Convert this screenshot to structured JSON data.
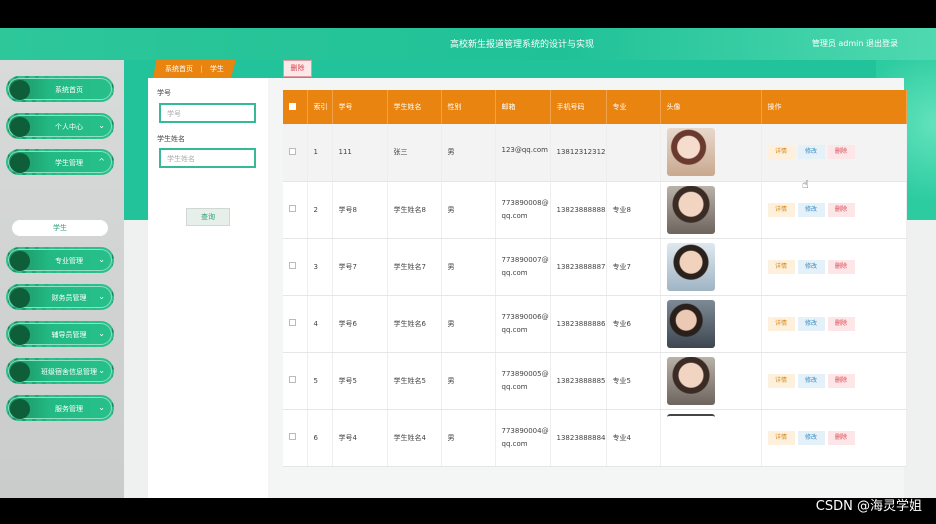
{
  "header": {
    "title": "高校新生报道管理系统的设计与实现",
    "admin": "管理员 admin 退出登录"
  },
  "sidebar": {
    "items": [
      {
        "label": "系统首页",
        "chevron": ""
      },
      {
        "label": "个人中心",
        "chevron": "⌄"
      },
      {
        "label": "学生管理",
        "chevron": "^"
      },
      {
        "label": "专业管理",
        "chevron": "⌄"
      },
      {
        "label": "财务员管理",
        "chevron": "⌄"
      },
      {
        "label": "辅导员管理",
        "chevron": "⌄"
      },
      {
        "label": "班级宿舍信息管理",
        "chevron": "⌄"
      },
      {
        "label": "服务管理",
        "chevron": "⌄"
      }
    ],
    "sub_item": "学生"
  },
  "breadcrumb": {
    "home": "系统首页",
    "sep": "|",
    "current": "学生"
  },
  "search": {
    "label_no": "学号",
    "placeholder_no": "学号",
    "label_name": "学生姓名",
    "placeholder_name": "学生姓名",
    "button": "查询"
  },
  "toolbar": {
    "delete": "删除"
  },
  "table": {
    "headers": [
      "",
      "索引",
      "学号",
      "学生姓名",
      "性别",
      "邮箱",
      "手机号码",
      "专业",
      "头像",
      "操作"
    ],
    "ops": {
      "detail": "详情",
      "edit": "修改",
      "delete": "删除"
    },
    "rows": [
      {
        "idx": "1",
        "no": "111",
        "name": "张三",
        "sex": "男",
        "email1": "123@qq.com",
        "email2": "",
        "phone": "13812312312",
        "major": ""
      },
      {
        "idx": "2",
        "no": "学号8",
        "name": "学生姓名8",
        "sex": "男",
        "email1": "773890008@",
        "email2": "qq.com",
        "phone": "13823888888",
        "major": "专业8"
      },
      {
        "idx": "3",
        "no": "学号7",
        "name": "学生姓名7",
        "sex": "男",
        "email1": "773890007@",
        "email2": "qq.com",
        "phone": "13823888887",
        "major": "专业7"
      },
      {
        "idx": "4",
        "no": "学号6",
        "name": "学生姓名6",
        "sex": "男",
        "email1": "773890006@",
        "email2": "qq.com",
        "phone": "13823888886",
        "major": "专业6"
      },
      {
        "idx": "5",
        "no": "学号5",
        "name": "学生姓名5",
        "sex": "男",
        "email1": "773890005@",
        "email2": "qq.com",
        "phone": "13823888885",
        "major": "专业5"
      },
      {
        "idx": "6",
        "no": "学号4",
        "name": "学生姓名4",
        "sex": "男",
        "email1": "773890004@",
        "email2": "qq.com",
        "phone": "13823888884",
        "major": "专业4"
      }
    ]
  },
  "watermark": "CSDN @海灵学姐"
}
